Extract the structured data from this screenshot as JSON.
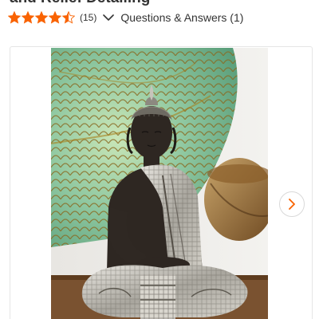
{
  "product": {
    "title": "and Relief Detailing"
  },
  "rating": {
    "value": 4.5,
    "max": 5,
    "review_count": "(15)",
    "star_color": "#f96302"
  },
  "qa": {
    "label": "Questions & Answers (1)"
  },
  "gallery": {
    "next_icon": "chevron-right-icon",
    "accent": "#f96302"
  }
}
